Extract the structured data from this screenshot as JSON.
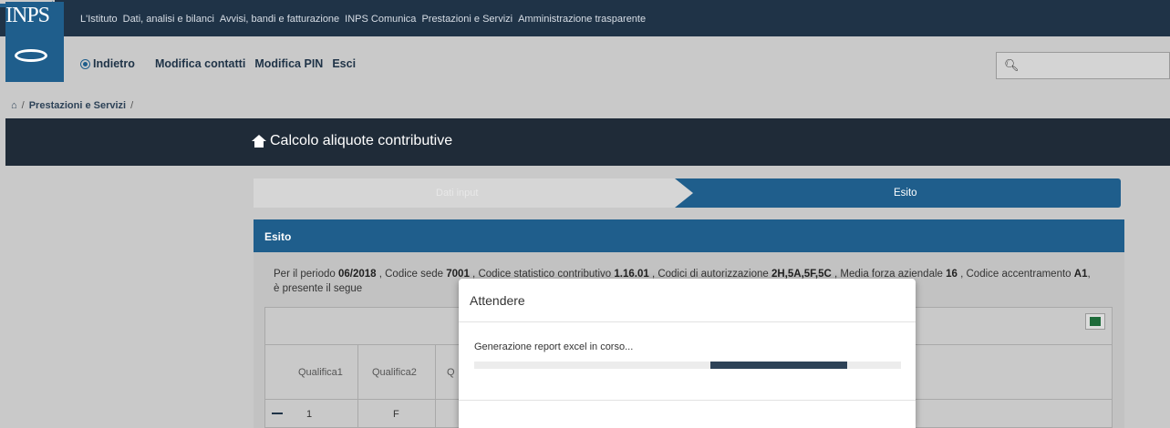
{
  "topnav": {
    "links": [
      "L'Istituto",
      "Dati, analisi e bilanci",
      "Avvisi, bandi e fatturazione",
      "INPS Comunica",
      "Prestazioni e Servizi",
      "Amministrazione trasparente"
    ]
  },
  "logo": {
    "text": "INPS"
  },
  "usermenu": {
    "back": "Indietro",
    "items": [
      "Modifica contatti",
      "Modifica PIN",
      "Esci"
    ]
  },
  "search": {
    "icon": "search-icon",
    "placeholder": ""
  },
  "breadcrumb": {
    "items": [
      "Prestazioni e Servizi"
    ],
    "separator": "/"
  },
  "page": {
    "title": "Calcolo aliquote contributive"
  },
  "stepper": {
    "step1": "Dati input",
    "step2": "Esito"
  },
  "esito": {
    "heading": "Esito",
    "text_prefix": "Per il periodo ",
    "periodo": "06/2018",
    "text_sede": " , Codice sede ",
    "sede": "7001",
    "text_csc": " , Codice statistico contributivo ",
    "csc": "1.16.01",
    "text_aut": " , Codici di autorizzazione ",
    "aut": "2H,5A,5F,5C",
    "text_forza": " , Media forza aziendale ",
    "forza": "16",
    "text_acc": " , Codice accentramento ",
    "acc": "A1",
    "text_tail": ", è presente il segue"
  },
  "table": {
    "headers": [
      "Qualifica1",
      "Qualifica2",
      "Q"
    ],
    "row": [
      "1",
      "F"
    ]
  },
  "modal": {
    "title": "Attendere",
    "message": "Generazione report excel in corso...",
    "progress_fraction": 0.32
  },
  "colors": {
    "nav": "#1f3347",
    "accent": "#1f5e8c",
    "header": "#1f2b38"
  }
}
